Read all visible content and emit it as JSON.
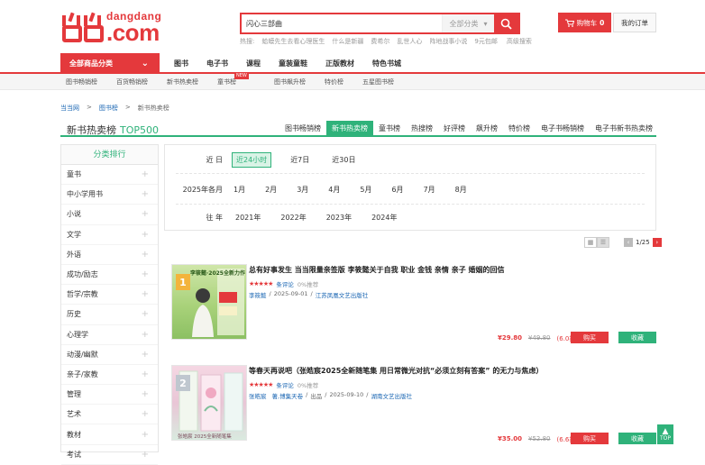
{
  "header": {
    "logo_small": "dangdang",
    "logo_big": ".com",
    "search_value": "闪心三部曲",
    "search_category": "全部分类",
    "hotwords_label": "热搜:",
    "hotwords": [
      "蛤蟆先生去看心理医生",
      "什么是新疆",
      "费希尔",
      "乱世人心",
      "阵地战事小说",
      "9元包邮"
    ],
    "advanced_search": "高级搜索",
    "cart_label": "购物车",
    "cart_count": "0",
    "orders_label": "我的订单"
  },
  "nav": {
    "all_categories": "全部商品分类",
    "main": [
      "图书",
      "电子书",
      "课程",
      "童装童鞋",
      "正版教材",
      "特色书城"
    ],
    "sub": [
      "图书畅销榜",
      "百货畅销榜",
      "新书热卖榜",
      "童书榜",
      "图书飙升榜",
      "特价榜",
      "五星图书榜"
    ],
    "new_tag": "NEW"
  },
  "breadcrumb": [
    "当当网",
    "图书榜",
    "新书热卖榜"
  ],
  "page_title": "新书热卖榜",
  "page_title_top": "TOP500",
  "rank_tabs": [
    "图书畅销榜",
    "新书热卖榜",
    "童书榜",
    "热搜榜",
    "好评榜",
    "飙升榜",
    "特价榜",
    "电子书畅销榜",
    "电子书新书热卖榜"
  ],
  "rank_tab_active": 1,
  "sidebar": {
    "heading": "分类排行",
    "items": [
      "童书",
      "中小学用书",
      "小说",
      "文学",
      "外语",
      "成功/励志",
      "哲学/宗教",
      "历史",
      "心理学",
      "动漫/幽默",
      "亲子/家教",
      "管理",
      "艺术",
      "教材",
      "考试"
    ],
    "plus": "+"
  },
  "filter": {
    "recent_label": "近 日",
    "recent": [
      "近24小时",
      "近7日",
      "近30日"
    ],
    "month_label": "2025年各月",
    "months": [
      "1月",
      "2月",
      "3月",
      "4月",
      "5月",
      "6月",
      "7月",
      "8月"
    ],
    "year_label": "往 年",
    "years": [
      "2021年",
      "2022年",
      "2023年",
      "2024年"
    ]
  },
  "pager": {
    "text": "1/25"
  },
  "products": [
    {
      "rank": "1",
      "title": "总有好事发生 当当限量亲签版 李筱懿关于自我 职业 金钱 亲情 亲子 婚姻的回信",
      "stars": "★★★★★",
      "comments": "条评论",
      "recommend": "0%推荐",
      "author": "李筱懿",
      "date": "2025-09-01",
      "publisher": "江苏凤凰文艺出版社",
      "price_now": "¥29.80",
      "price_old": "¥49.80",
      "discount": "(6.0折)",
      "buy": "购买",
      "fav": "收藏",
      "cover_text": "李筱懿·2025全新力作"
    },
    {
      "rank": "2",
      "title": "等春天再说吧（张皓宸2025全新随笔集 用日常微光对抗“必须立刻有答案” 的无力与焦虑）",
      "stars": "★★★★★",
      "comments": "条评论",
      "recommend": "0%推荐",
      "author": "张皓宸",
      "author_extra": "著,博集天卷",
      "pub_prefix": "出品",
      "date": "2025-09-10",
      "publisher": "湖南文艺出版社",
      "price_now": "¥35.00",
      "price_old": "¥52.80",
      "discount": "(6.6折)",
      "buy": "购买",
      "fav": "收藏",
      "cover_text": "张皓宸 2025全新随笔集"
    }
  ],
  "to_top": "TOP",
  "colors": {
    "brand_red": "#e4393c",
    "accent_green": "#2fb27a"
  }
}
